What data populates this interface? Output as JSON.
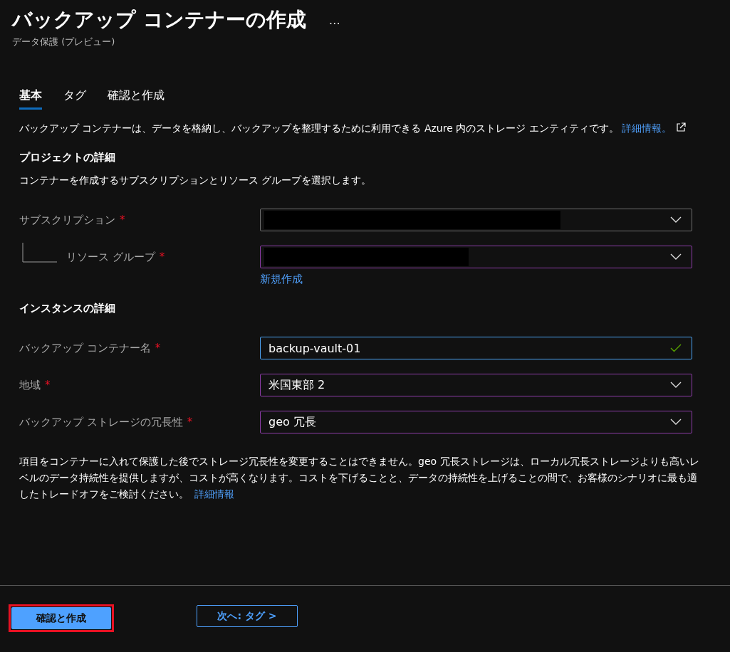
{
  "header": {
    "title": "バックアップ コンテナーの作成",
    "more": "…",
    "subtitle": "データ保護 (プレビュー)"
  },
  "tabs": [
    {
      "label": "基本",
      "selected": true
    },
    {
      "label": "タグ",
      "selected": false
    },
    {
      "label": "確認と作成",
      "selected": false
    }
  ],
  "intro": {
    "text": "バックアップ コンテナーは、データを格納し、バックアップを整理するために利用できる Azure 内のストレージ エンティティです。",
    "link": "詳細情報。",
    "external": true
  },
  "sections": [
    {
      "heading": "プロジェクトの詳細",
      "description": "コンテナーを作成するサブスクリプションとリソース グループを選択します。",
      "fields": [
        {
          "label": "サブスクリプション",
          "required_mark": "*",
          "nested": false,
          "kind": "dropdown",
          "edited": false,
          "focused": false,
          "redacted": true
        },
        {
          "label": "リソース グループ",
          "required_mark": "*",
          "nested": true,
          "kind": "dropdown",
          "edited": true,
          "focused": false,
          "redacted": true,
          "link": "新規作成"
        }
      ]
    },
    {
      "heading": "インスタンスの詳細",
      "fields": [
        {
          "label": "バックアップ コンテナー名",
          "required_mark": "*",
          "nested": false,
          "kind": "text",
          "focused": true,
          "value": "backup-vault-01",
          "valid": true
        },
        {
          "label": "地域",
          "required_mark": "*",
          "nested": false,
          "kind": "dropdown",
          "edited": true,
          "focused": false,
          "value": "米国東部 2"
        },
        {
          "label": "バックアップ ストレージの冗長性",
          "required_mark": "*",
          "nested": false,
          "kind": "dropdown",
          "edited": true,
          "focused": false,
          "value": "geo 冗長"
        }
      ]
    }
  ],
  "note": {
    "text": "項目をコンテナーに入れて保護した後でストレージ冗長性を変更することはできません。geo 冗長ストレージは、ローカル冗長ストレージよりも高いレベルのデータ持続性を提供しますが、コストが高くなります。コストを下げることと、データの持続性を上げることの間で、お客様のシナリオに最も適したトレードオフをご検討ください。",
    "link": "詳細情報"
  },
  "buttons": [
    {
      "label": "確認と作成",
      "kind": "primary",
      "highlighted": true
    },
    {
      "label": "次へ: タグ >",
      "kind": "secondary",
      "highlighted": false
    }
  ]
}
